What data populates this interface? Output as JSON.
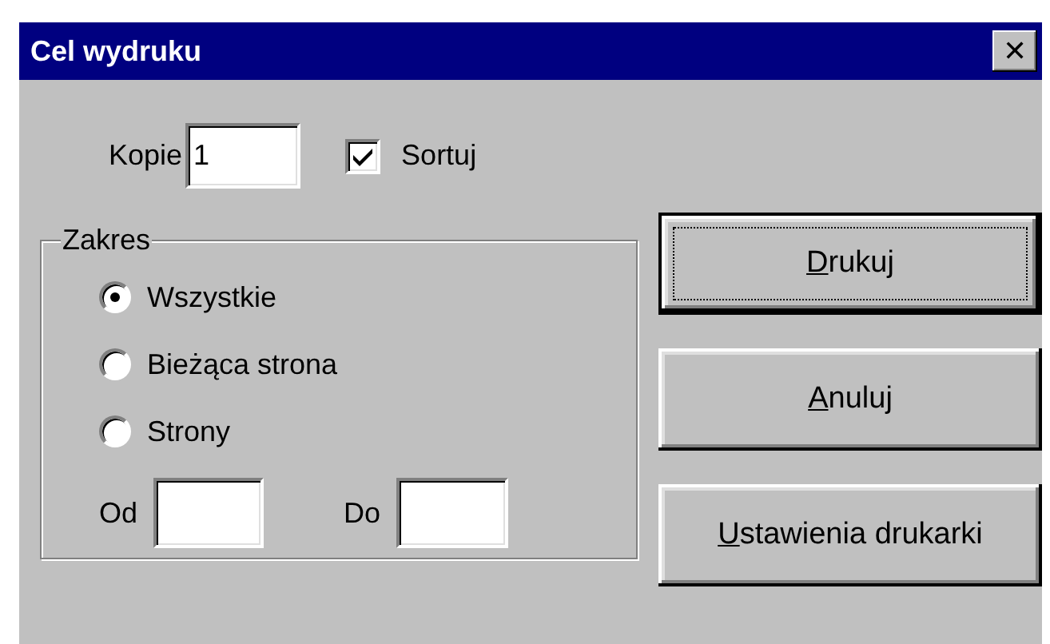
{
  "window": {
    "title": "Cel wydruku",
    "close_button": "✕"
  },
  "copies": {
    "label": "Kopie",
    "value": "1"
  },
  "collate": {
    "label": "Sortuj",
    "checked": true
  },
  "range": {
    "title": "Zakres",
    "options": [
      {
        "label": "Wszystkie",
        "selected": true
      },
      {
        "label": "Bieżąca strona",
        "selected": false
      },
      {
        "label": "Strony",
        "selected": false
      }
    ],
    "from": {
      "label": "Od"
    },
    "to": {
      "label": "Do"
    }
  },
  "buttons": [
    {
      "label": "Drukuj",
      "default": true,
      "underline_first": true
    },
    {
      "label": "Anuluj",
      "default": false,
      "underline_first": true
    },
    {
      "label": "Ustawienia drukarki",
      "default": false,
      "underline_first": true
    }
  ]
}
